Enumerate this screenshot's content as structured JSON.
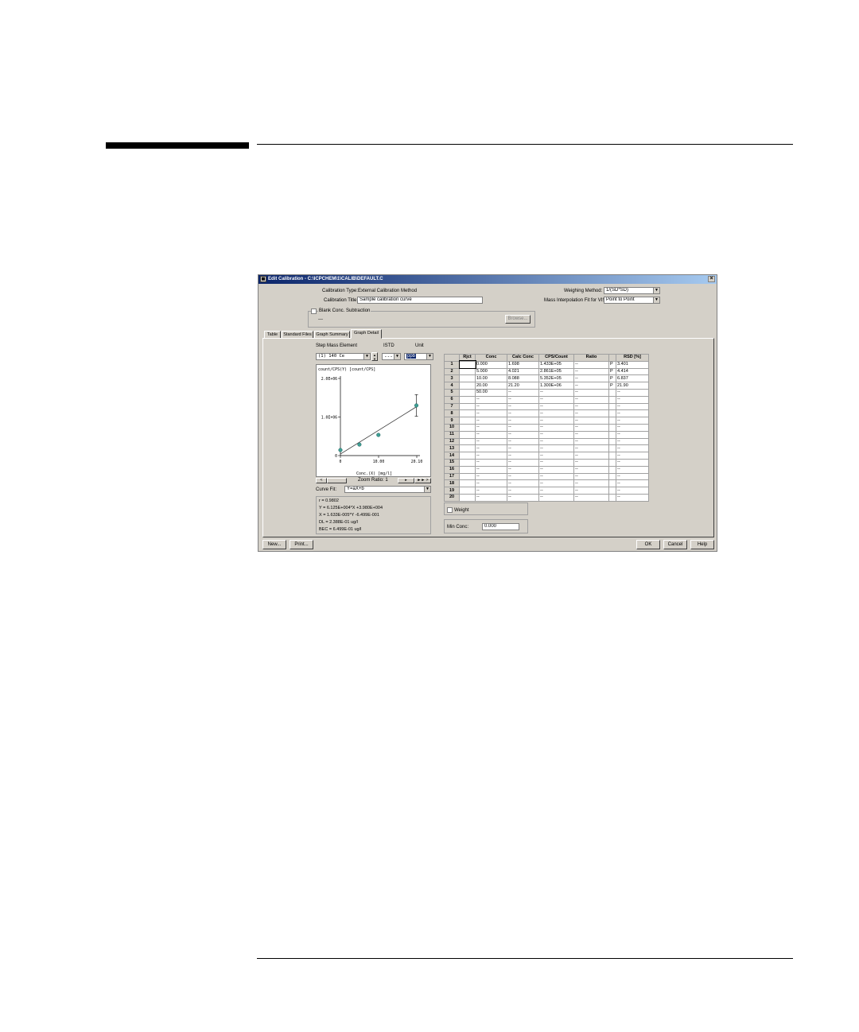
{
  "window": {
    "title": "Edit Calibration - C:\\ICPCHEM\\1\\CALIB\\DEFAULT.C",
    "icon": "app-icon",
    "close_glyph": "×"
  },
  "header": {
    "calibration_type_label": "Calibration Type:",
    "calibration_type_value": "External Calibration Method",
    "calibration_title_label": "Calibration Title:",
    "calibration_title_value": "Sample calibration curve",
    "blank_subtraction_label": "Blank Conc. Subtraction",
    "blank_subtraction_value": "---",
    "browse_label": "Browse...",
    "weighing_method_label": "Weighing Method:",
    "weighing_method_value": "1/(SD*SD)",
    "mass_interp_label": "Mass Interpolation Fit for VIS:",
    "mass_interp_value": "Point to Point"
  },
  "tabs": [
    "Table",
    "Standard Files",
    "Graph Summary",
    "Graph Detail"
  ],
  "active_tab": "Graph Detail",
  "selectors": {
    "step_mass_label": "Step Mass Element",
    "step_mass_value": "(1) 140 Ce",
    "istd_label": "ISTD",
    "istd_value": "---",
    "unit_label": "Unit",
    "unit_value": "ppb"
  },
  "chart_data": {
    "type": "scatter",
    "title": "count/CPS(Y) [count/CPS]",
    "xlabel": "Conc.(X) [mg/l]",
    "xlim": [
      0,
      20.1
    ],
    "ylim": [
      0,
      2000000.0
    ],
    "x_ticks": [
      "0",
      "10.00",
      "20.10"
    ],
    "y_ticks": [
      "0",
      "1.0E+06",
      "2.0E+06"
    ],
    "points": [
      {
        "x": 0.0,
        "y": 143300.0
      },
      {
        "x": 5.0,
        "y": 286100.0
      },
      {
        "x": 10.0,
        "y": 535200.0
      },
      {
        "x": 20.0,
        "y": 1300000.0
      }
    ],
    "fit_line": {
      "x": [
        0,
        20.0
      ],
      "y": [
        39800.0,
        1265000.0
      ]
    },
    "error_bar": {
      "x": 20.0,
      "low": 1020000.0,
      "high": 1580000.0
    }
  },
  "zoom": {
    "left_arrow": "<",
    "label": "Zoom Ratio: 1",
    "right_arrow": "▸",
    "fast_right": "►► >"
  },
  "curve_fit": {
    "label": "Curve Fit:",
    "value": "Y=aX+b"
  },
  "fit_info": {
    "r": "r = 0.9802",
    "y_eq": "Y = 6.125E+004*X +3.980E+004",
    "x_eq": "X = 1.633E-005*Y -6.499E-001",
    "dl": "DL = 2.388E-01 ug/l",
    "bec": "BEC = 6.499E-01 ug/l"
  },
  "table": {
    "headers": [
      "",
      "Rjct",
      "Conc",
      "Calc Conc",
      "CPS/Count",
      "Ratio",
      "",
      "RSD [%]"
    ],
    "rows": [
      [
        "1",
        "",
        "0.000",
        "1.698",
        "1.433E+05",
        "--",
        "P",
        "3.401"
      ],
      [
        "2",
        "",
        "5.000",
        "4.021",
        "2.861E+05",
        "--",
        "P",
        "4.414"
      ],
      [
        "3",
        "",
        "10.00",
        "8.088",
        "5.352E+05",
        "--",
        "P",
        "6.837"
      ],
      [
        "4",
        "",
        "20.00",
        "21.20",
        "1.300E+06",
        "--",
        "P",
        "21.90"
      ],
      [
        "5",
        "",
        "50.00",
        "--",
        "--",
        "--",
        "",
        "--"
      ],
      [
        "6",
        "",
        "--",
        "--",
        "--",
        "--",
        "",
        "--"
      ],
      [
        "7",
        "",
        "--",
        "--",
        "--",
        "--",
        "",
        "--"
      ],
      [
        "8",
        "",
        "--",
        "--",
        "--",
        "--",
        "",
        "--"
      ],
      [
        "9",
        "",
        "--",
        "--",
        "--",
        "--",
        "",
        "--"
      ],
      [
        "10",
        "",
        "--",
        "--",
        "--",
        "--",
        "",
        "--"
      ],
      [
        "11",
        "",
        "--",
        "--",
        "--",
        "--",
        "",
        "--"
      ],
      [
        "12",
        "",
        "--",
        "--",
        "--",
        "--",
        "",
        "--"
      ],
      [
        "13",
        "",
        "--",
        "--",
        "--",
        "--",
        "",
        "--"
      ],
      [
        "14",
        "",
        "--",
        "--",
        "--",
        "--",
        "",
        "--"
      ],
      [
        "15",
        "",
        "--",
        "--",
        "--",
        "--",
        "",
        "--"
      ],
      [
        "16",
        "",
        "--",
        "--",
        "--",
        "--",
        "",
        "--"
      ],
      [
        "17",
        "",
        "--",
        "--",
        "--",
        "--",
        "",
        "--"
      ],
      [
        "18",
        "",
        "--",
        "--",
        "--",
        "--",
        "",
        "--"
      ],
      [
        "19",
        "",
        "--",
        "--",
        "--",
        "--",
        "",
        "--"
      ],
      [
        "20",
        "",
        "--",
        "--",
        "--",
        "--",
        "",
        "--"
      ]
    ]
  },
  "weight_label": "Weight",
  "min_conc_label": "Min Conc:",
  "min_conc_value": "0.000",
  "buttons": {
    "new": "New...",
    "print": "Print...",
    "ok": "OK",
    "cancel": "Cancel",
    "help": "Help"
  }
}
